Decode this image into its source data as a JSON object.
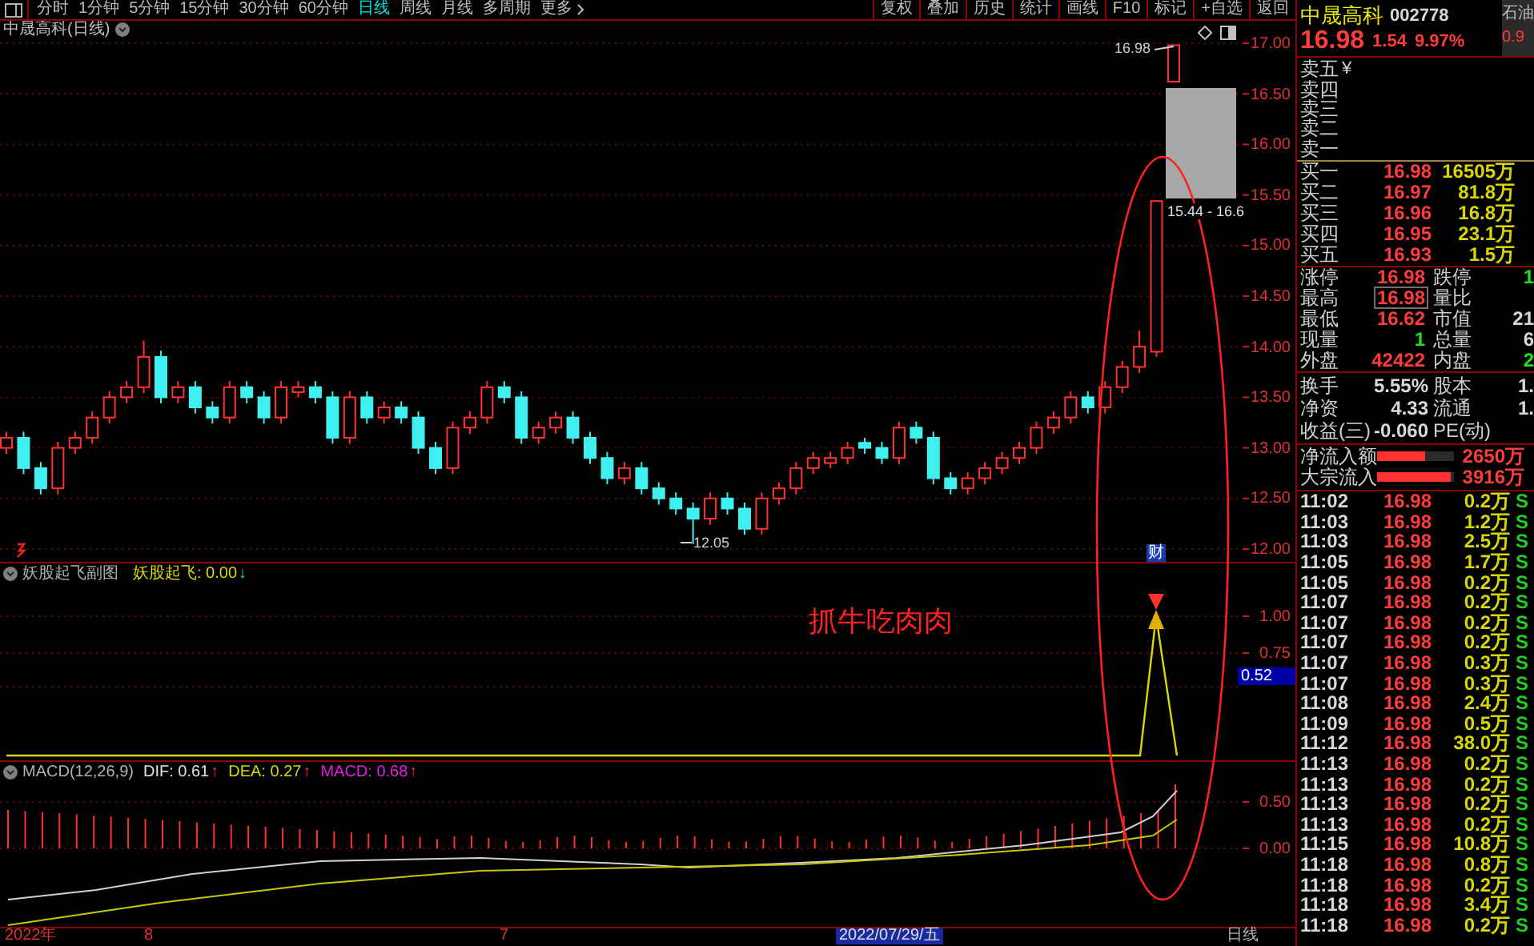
{
  "toolbar": {
    "periods": [
      {
        "label": "分时",
        "selected": false
      },
      {
        "label": "1分钟",
        "selected": false
      },
      {
        "label": "5分钟",
        "selected": false
      },
      {
        "label": "15分钟",
        "selected": false
      },
      {
        "label": "30分钟",
        "selected": false
      },
      {
        "label": "60分钟",
        "selected": false
      },
      {
        "label": "日线",
        "selected": true
      },
      {
        "label": "周线",
        "selected": false
      },
      {
        "label": "月线",
        "selected": false
      },
      {
        "label": "多周期",
        "selected": false
      }
    ],
    "more": "更多",
    "actions": [
      "复权",
      "叠加",
      "历史",
      "统计",
      "画线",
      "F10",
      "标记",
      "+自选",
      "返回"
    ]
  },
  "main_chart": {
    "title": "中晟高科(日线)",
    "chart_data": {
      "type": "candlestick",
      "grid": true,
      "ylim": [
        12,
        17
      ],
      "yticks": [
        {
          "value": 17,
          "label": "17.00"
        },
        {
          "value": 16.5,
          "label": "16.50"
        },
        {
          "value": 16,
          "label": "16.00"
        },
        {
          "value": 15.5,
          "label": "15.50"
        },
        {
          "value": 15,
          "label": "15.00"
        },
        {
          "value": 14.5,
          "label": "14.50"
        },
        {
          "value": 14,
          "label": "14.00"
        },
        {
          "value": 13.5,
          "label": "13.50"
        },
        {
          "value": 13,
          "label": "13.00"
        },
        {
          "value": 12.5,
          "label": "12.50"
        },
        {
          "value": 12,
          "label": "12.00"
        }
      ],
      "ohlc": [
        [
          13.0,
          13.16,
          12.94,
          13.1
        ],
        [
          13.1,
          13.16,
          12.74,
          12.8
        ],
        [
          12.8,
          12.86,
          12.54,
          12.6
        ],
        [
          12.6,
          13.06,
          12.54,
          13.0
        ],
        [
          13.0,
          13.16,
          12.94,
          13.1
        ],
        [
          13.1,
          13.36,
          13.04,
          13.3
        ],
        [
          13.3,
          13.56,
          13.24,
          13.5
        ],
        [
          13.5,
          13.66,
          13.44,
          13.6
        ],
        [
          13.6,
          14.06,
          13.54,
          13.9
        ],
        [
          13.9,
          13.96,
          13.44,
          13.5
        ],
        [
          13.5,
          13.66,
          13.44,
          13.6
        ],
        [
          13.6,
          13.66,
          13.34,
          13.4
        ],
        [
          13.4,
          13.46,
          13.24,
          13.3
        ],
        [
          13.3,
          13.66,
          13.24,
          13.6
        ],
        [
          13.6,
          13.66,
          13.44,
          13.5
        ],
        [
          13.5,
          13.56,
          13.24,
          13.3
        ],
        [
          13.3,
          13.66,
          13.24,
          13.6
        ],
        [
          13.55,
          13.66,
          13.5,
          13.6
        ],
        [
          13.6,
          13.66,
          13.44,
          13.5
        ],
        [
          13.5,
          13.56,
          13.04,
          13.1
        ],
        [
          13.1,
          13.56,
          13.04,
          13.5
        ],
        [
          13.5,
          13.56,
          13.24,
          13.3
        ],
        [
          13.3,
          13.46,
          13.24,
          13.4
        ],
        [
          13.4,
          13.46,
          13.24,
          13.3
        ],
        [
          13.3,
          13.36,
          12.94,
          13.0
        ],
        [
          13.0,
          13.06,
          12.74,
          12.8
        ],
        [
          12.8,
          13.26,
          12.74,
          13.2
        ],
        [
          13.2,
          13.36,
          13.14,
          13.3
        ],
        [
          13.3,
          13.66,
          13.24,
          13.6
        ],
        [
          13.6,
          13.66,
          13.44,
          13.5
        ],
        [
          13.5,
          13.56,
          13.04,
          13.1
        ],
        [
          13.1,
          13.26,
          13.04,
          13.2
        ],
        [
          13.2,
          13.36,
          13.14,
          13.3
        ],
        [
          13.3,
          13.36,
          13.04,
          13.1
        ],
        [
          13.1,
          13.16,
          12.84,
          12.9
        ],
        [
          12.9,
          12.96,
          12.64,
          12.7
        ],
        [
          12.7,
          12.86,
          12.64,
          12.8
        ],
        [
          12.8,
          12.86,
          12.54,
          12.6
        ],
        [
          12.6,
          12.66,
          12.44,
          12.5
        ],
        [
          12.5,
          12.56,
          12.34,
          12.4
        ],
        [
          12.4,
          12.46,
          12.05,
          12.3
        ],
        [
          12.3,
          12.56,
          12.24,
          12.5
        ],
        [
          12.5,
          12.56,
          12.34,
          12.4
        ],
        [
          12.4,
          12.46,
          12.14,
          12.2
        ],
        [
          12.2,
          12.56,
          12.14,
          12.5
        ],
        [
          12.5,
          12.66,
          12.44,
          12.6
        ],
        [
          12.6,
          12.86,
          12.54,
          12.8
        ],
        [
          12.8,
          12.96,
          12.74,
          12.9
        ],
        [
          12.85,
          12.96,
          12.8,
          12.9
        ],
        [
          12.9,
          13.06,
          12.84,
          13.0
        ],
        [
          13.05,
          13.1,
          12.94,
          13.0
        ],
        [
          13.0,
          13.06,
          12.84,
          12.9
        ],
        [
          12.9,
          13.26,
          12.84,
          13.2
        ],
        [
          13.2,
          13.26,
          13.04,
          13.1
        ],
        [
          13.1,
          13.16,
          12.64,
          12.7
        ],
        [
          12.7,
          12.76,
          12.54,
          12.6
        ],
        [
          12.6,
          12.76,
          12.54,
          12.7
        ],
        [
          12.7,
          12.86,
          12.64,
          12.8
        ],
        [
          12.8,
          12.96,
          12.74,
          12.9
        ],
        [
          12.9,
          13.06,
          12.84,
          13.0
        ],
        [
          13.0,
          13.26,
          12.94,
          13.2
        ],
        [
          13.2,
          13.36,
          13.14,
          13.3
        ],
        [
          13.3,
          13.56,
          13.24,
          13.5
        ],
        [
          13.5,
          13.56,
          13.34,
          13.4
        ],
        [
          13.4,
          13.66,
          13.34,
          13.6
        ],
        [
          13.6,
          13.86,
          13.54,
          13.8
        ],
        [
          13.8,
          14.16,
          13.74,
          14.0
        ],
        [
          13.95,
          15.44,
          13.9,
          15.44
        ],
        [
          16.62,
          16.98,
          16.62,
          16.98
        ]
      ]
    },
    "high_label": "16.98",
    "range_label": "15.44 - 16.6",
    "low_label": "12.05",
    "badge": "财"
  },
  "indicator": {
    "title": "妖股起飞副图",
    "reading": "妖股起飞: 0.00",
    "arrow": "↓",
    "y_ticks": [
      "1.00",
      "0.75"
    ],
    "current": "0.52",
    "caption": "抓牛吃肉肉"
  },
  "macd": {
    "title": "MACD(12,26,9)",
    "dif": "DIF: 0.61",
    "dif_arrow": "↑",
    "dea": "DEA: 0.27",
    "dea_arrow": "↑",
    "macd": "MACD: 0.68",
    "macd_arrow": "↑",
    "y_ticks": [
      "0.50",
      "0.00"
    ]
  },
  "time_axis": {
    "labels": [
      "2022年",
      "8",
      "7"
    ],
    "cursor_date": "2022/07/29/五",
    "period": "日线"
  },
  "quote": {
    "name": "中晟高科",
    "code": "002778",
    "price": "16.98",
    "change": "1.54",
    "change_pct": "9.97%",
    "side_panel": {
      "label": "石油",
      "value": "0.9"
    },
    "currency_mark": "¥",
    "sell": [
      "卖五",
      "卖四",
      "卖三",
      "卖二",
      "卖一"
    ],
    "buy": [
      {
        "label": "买一",
        "price": "16.98",
        "volume": "16505万"
      },
      {
        "label": "买二",
        "price": "16.97",
        "volume": "81.8万"
      },
      {
        "label": "买三",
        "price": "16.96",
        "volume": "16.8万"
      },
      {
        "label": "买四",
        "price": "16.95",
        "volume": "23.1万"
      },
      {
        "label": "买五",
        "price": "16.93",
        "volume": "1.5万"
      }
    ],
    "stats": [
      {
        "left": {
          "label": "涨停",
          "value": "16.98",
          "color": "#ff3c3c",
          "highlighted": false
        },
        "right": {
          "label": "跌停",
          "value": "1",
          "color": "#20e020"
        }
      },
      {
        "left": {
          "label": "最高",
          "value": "16.98",
          "color": "#ff3c3c",
          "highlighted": true
        },
        "right": {
          "label": "量比"
        }
      },
      {
        "left": {
          "label": "最低",
          "value": "16.62",
          "color": "#ff3c3c",
          "highlighted": false
        },
        "right": {
          "label": "市值",
          "value": "21",
          "color": "#d8d8d8"
        }
      },
      {
        "left": {
          "label": "现量",
          "value": "1",
          "color": "#20e020",
          "highlighted": false
        },
        "right": {
          "label": "总量",
          "value": "6",
          "color": "#d8d8d8"
        }
      },
      {
        "left": {
          "label": "外盘",
          "value": "42422",
          "color": "#ff3c3c",
          "highlighted": false
        },
        "right": {
          "label": "内盘",
          "value": "2",
          "color": "#20e020"
        }
      }
    ],
    "fundamentals": [
      {
        "left": {
          "label": "换手",
          "value": "5.55%"
        },
        "right": {
          "label": "股本",
          "value": "1."
        }
      },
      {
        "left": {
          "label": "净资",
          "value": "4.33"
        },
        "right": {
          "label": "流通",
          "value": "1."
        }
      },
      {
        "left": {
          "label": "收益(三)",
          "value": "-0.060"
        },
        "right": {
          "label": "PE(动)"
        }
      }
    ],
    "flows": [
      {
        "label": "净流入额",
        "level": 0.63,
        "value": "2650万"
      },
      {
        "label": "大宗流入",
        "level": 0.96,
        "value": "3916万"
      }
    ],
    "trades": [
      {
        "time": "11:02",
        "price": "16.98",
        "volume": "0.2万",
        "side": "S"
      },
      {
        "time": "11:03",
        "price": "16.98",
        "volume": "1.2万",
        "side": "S"
      },
      {
        "time": "11:03",
        "price": "16.98",
        "volume": "2.5万",
        "side": "S"
      },
      {
        "time": "11:05",
        "price": "16.98",
        "volume": "1.7万",
        "side": "S"
      },
      {
        "time": "11:05",
        "price": "16.98",
        "volume": "0.2万",
        "side": "S"
      },
      {
        "time": "11:07",
        "price": "16.98",
        "volume": "0.2万",
        "side": "S"
      },
      {
        "time": "11:07",
        "price": "16.98",
        "volume": "0.2万",
        "side": "S"
      },
      {
        "time": "11:07",
        "price": "16.98",
        "volume": "0.2万",
        "side": "S"
      },
      {
        "time": "11:07",
        "price": "16.98",
        "volume": "0.3万",
        "side": "S"
      },
      {
        "time": "11:07",
        "price": "16.98",
        "volume": "0.3万",
        "side": "S"
      },
      {
        "time": "11:08",
        "price": "16.98",
        "volume": "2.4万",
        "side": "S"
      },
      {
        "time": "11:09",
        "price": "16.98",
        "volume": "0.5万",
        "side": "S"
      },
      {
        "time": "11:12",
        "price": "16.98",
        "volume": "38.0万",
        "side": "S"
      },
      {
        "time": "11:13",
        "price": "16.98",
        "volume": "0.2万",
        "side": "S"
      },
      {
        "time": "11:13",
        "price": "16.98",
        "volume": "0.2万",
        "side": "S"
      },
      {
        "time": "11:13",
        "price": "16.98",
        "volume": "0.2万",
        "side": "S"
      },
      {
        "time": "11:13",
        "price": "16.98",
        "volume": "0.2万",
        "side": "S"
      },
      {
        "time": "11:15",
        "price": "16.98",
        "volume": "10.8万",
        "side": "S"
      },
      {
        "time": "11:18",
        "price": "16.98",
        "volume": "0.8万",
        "side": "S"
      },
      {
        "time": "11:18",
        "price": "16.98",
        "volume": "0.2万",
        "side": "S"
      },
      {
        "time": "11:18",
        "price": "16.98",
        "volume": "3.4万",
        "side": "S"
      },
      {
        "time": "11:18",
        "price": "16.98",
        "volume": "0.2万",
        "side": "S"
      }
    ]
  }
}
